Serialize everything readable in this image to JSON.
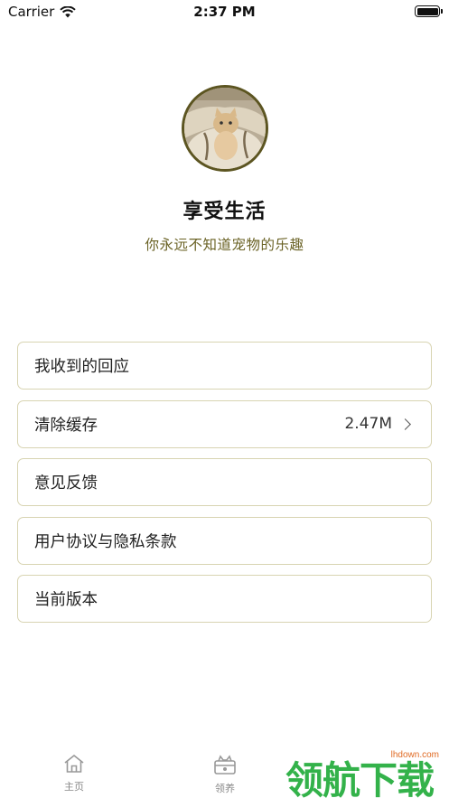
{
  "status_bar": {
    "carrier": "Carrier",
    "time": "2:37 PM"
  },
  "profile": {
    "name": "享受生活",
    "tagline": "你永远不知道宠物的乐趣"
  },
  "menu": {
    "items": [
      {
        "label": "我收到的回应",
        "value": ""
      },
      {
        "label": "清除缓存",
        "value": "2.47M"
      },
      {
        "label": "意见反馈",
        "value": ""
      },
      {
        "label": "用户协议与隐私条款",
        "value": ""
      },
      {
        "label": "当前版本",
        "value": ""
      }
    ]
  },
  "tabbar": {
    "tabs": [
      {
        "label": "主页",
        "icon": "home-icon"
      },
      {
        "label": "领养",
        "icon": "adopt-icon"
      }
    ]
  },
  "watermark": {
    "brand": "领航下载",
    "url": "lhdown.com"
  },
  "colors": {
    "accent": "#6b6326",
    "border": "#d8d4b2",
    "watermark": "#33b24a"
  }
}
